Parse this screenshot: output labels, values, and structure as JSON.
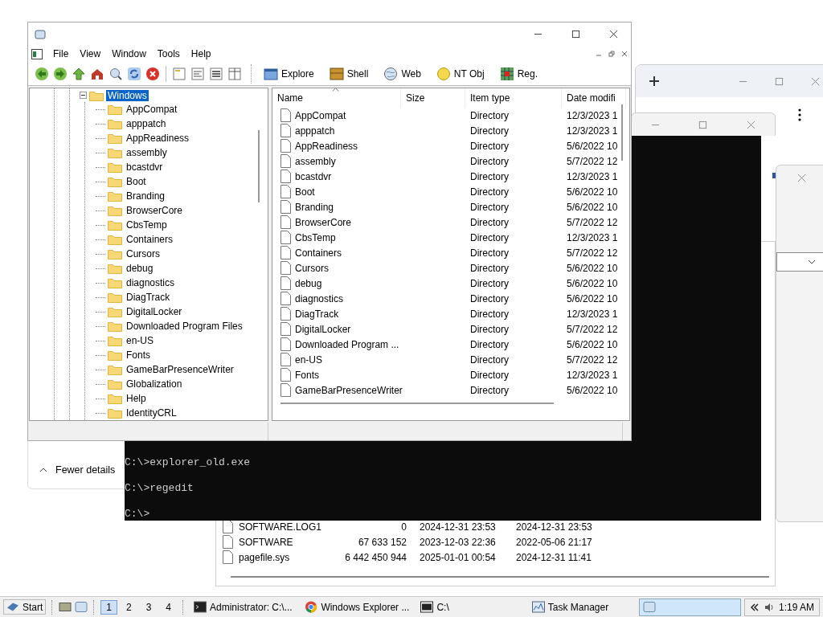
{
  "main_window": {
    "menu": [
      "File",
      "View",
      "Window",
      "Tools",
      "Help"
    ],
    "toolbar_links": [
      {
        "label": "Explore",
        "kind": "explore"
      },
      {
        "label": "Shell",
        "kind": "shell"
      },
      {
        "label": "Web",
        "kind": "web"
      },
      {
        "label": "NT Obj",
        "kind": "ntobj"
      },
      {
        "label": "Reg.",
        "kind": "reg"
      }
    ],
    "tree": {
      "label": "Windows",
      "selected": true,
      "expanded": true,
      "children": [
        {
          "label": "AppCompat",
          "selected": false
        },
        {
          "label": "apppatch",
          "selected": false
        },
        {
          "label": "AppReadiness",
          "selected": false
        },
        {
          "label": "assembly",
          "selected": false
        },
        {
          "label": "bcastdvr",
          "selected": false
        },
        {
          "label": "Boot",
          "selected": false
        },
        {
          "label": "Branding",
          "selected": false
        },
        {
          "label": "BrowserCore",
          "selected": false
        },
        {
          "label": "CbsTemp",
          "selected": false
        },
        {
          "label": "Containers",
          "selected": false
        },
        {
          "label": "Cursors",
          "selected": false
        },
        {
          "label": "debug",
          "selected": false
        },
        {
          "label": "diagnostics",
          "selected": false
        },
        {
          "label": "DiagTrack",
          "selected": false
        },
        {
          "label": "DigitalLocker",
          "selected": false
        },
        {
          "label": "Downloaded Program Files",
          "selected": false
        },
        {
          "label": "en-US",
          "selected": false
        },
        {
          "label": "Fonts",
          "selected": false
        },
        {
          "label": "GameBarPresenceWriter",
          "selected": false
        },
        {
          "label": "Globalization",
          "selected": false
        },
        {
          "label": "Help",
          "selected": false
        },
        {
          "label": "IdentityCRL",
          "selected": false
        }
      ]
    },
    "list": {
      "columns": [
        {
          "label": "Name",
          "sorted": true
        },
        {
          "label": "Size",
          "sorted": false
        },
        {
          "label": "Item type",
          "sorted": false
        },
        {
          "label": "Date modifi",
          "sorted": false
        }
      ],
      "rows": [
        {
          "name": "AppCompat",
          "type": "Directory",
          "date": "12/3/2023 1"
        },
        {
          "name": "apppatch",
          "type": "Directory",
          "date": "12/3/2023 1"
        },
        {
          "name": "AppReadiness",
          "type": "Directory",
          "date": "5/6/2022 10"
        },
        {
          "name": "assembly",
          "type": "Directory",
          "date": "5/7/2022 12"
        },
        {
          "name": "bcastdvr",
          "type": "Directory",
          "date": "12/3/2023 1"
        },
        {
          "name": "Boot",
          "type": "Directory",
          "date": "5/6/2022 10"
        },
        {
          "name": "Branding",
          "type": "Directory",
          "date": "5/6/2022 10"
        },
        {
          "name": "BrowserCore",
          "type": "Directory",
          "date": "5/7/2022 12"
        },
        {
          "name": "CbsTemp",
          "type": "Directory",
          "date": "12/3/2023 1"
        },
        {
          "name": "Containers",
          "type": "Directory",
          "date": "5/7/2022 12"
        },
        {
          "name": "Cursors",
          "type": "Directory",
          "date": "5/6/2022 10"
        },
        {
          "name": "debug",
          "type": "Directory",
          "date": "5/6/2022 10"
        },
        {
          "name": "diagnostics",
          "type": "Directory",
          "date": "5/6/2022 10"
        },
        {
          "name": "DiagTrack",
          "type": "Directory",
          "date": "12/3/2023 1"
        },
        {
          "name": "DigitalLocker",
          "type": "Directory",
          "date": "5/7/2022 12"
        },
        {
          "name": "Downloaded Program ...",
          "type": "Directory",
          "date": "5/6/2022 10"
        },
        {
          "name": "en-US",
          "type": "Directory",
          "date": "5/7/2022 12"
        },
        {
          "name": "Fonts",
          "type": "Directory",
          "date": "12/3/2023 1"
        },
        {
          "name": "GameBarPresenceWriter",
          "type": "Directory",
          "date": "5/6/2022 10"
        }
      ]
    }
  },
  "task_manager": {
    "details_toggle": "Fewer details"
  },
  "console": {
    "lines": [
      "C:\\>explorer_old.exe",
      "C:\\>regedit",
      "C:\\>"
    ]
  },
  "background_explorer": {
    "rows": [
      {
        "name": "SOFTWARE.LOG1",
        "size": "0",
        "modified": "2024-12-31 23:53",
        "created": "2024-12-31 23:53"
      },
      {
        "name": "SOFTWARE",
        "size": "67 633 152",
        "modified": "2023-12-03 22:36",
        "created": "2022-05-06 21:17"
      },
      {
        "name": "pagefile.sys",
        "size": "6 442 450 944",
        "modified": "2025-01-01 00:54",
        "created": "2024-12-31 11:41"
      }
    ]
  },
  "taskbar": {
    "start": "Start",
    "desktops": [
      {
        "label": "1",
        "selected": true
      },
      {
        "label": "2",
        "selected": false
      },
      {
        "label": "3",
        "selected": false
      },
      {
        "label": "4",
        "selected": false
      }
    ],
    "tasks": [
      {
        "label": "Administrator: C:\\...",
        "kind": "console",
        "selected": false
      },
      {
        "label": "Windows Explorer ...",
        "kind": "browser",
        "selected": false
      },
      {
        "label": "C:\\",
        "kind": "archive",
        "selected": false
      },
      {
        "label": "Task Manager",
        "kind": "taskmgr",
        "selected": false
      },
      {
        "kind": "blank",
        "selected": true
      }
    ],
    "clock": "1:19 AM"
  }
}
